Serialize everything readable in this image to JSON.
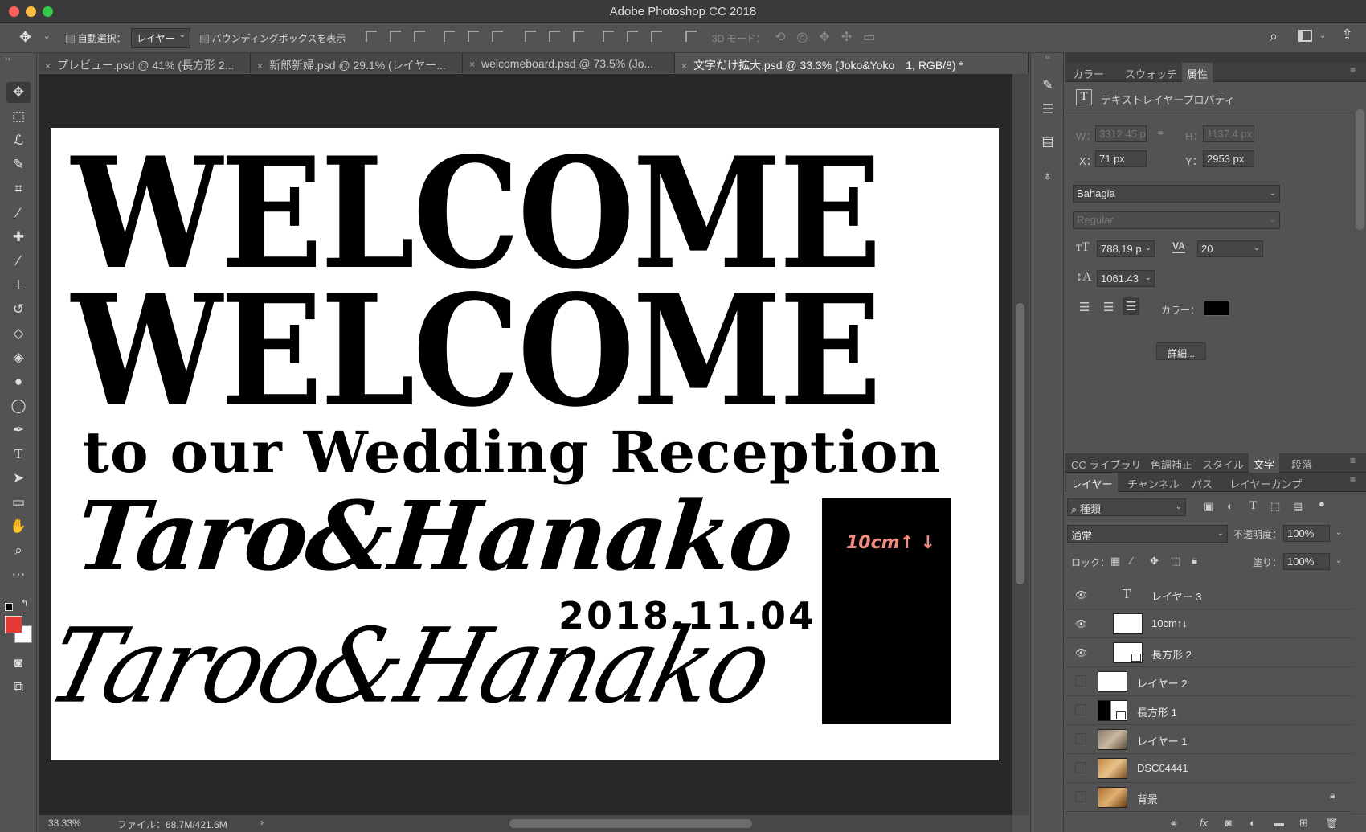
{
  "window": {
    "title": "Adobe Photoshop CC 2018"
  },
  "options_bar": {
    "auto_select_label": "自動選択：",
    "auto_select_target": "レイヤー",
    "bounding_box_label": "バウンディングボックスを表示",
    "mode_3d_label": "3D モード："
  },
  "tabs": [
    {
      "label": "プレビュー.psd @ 41% (長方形 2...",
      "close": "×"
    },
    {
      "label": "新郎新婦.psd @ 29.1% (レイヤー...",
      "close": "×"
    },
    {
      "label": "welcomeboard.psd @ 73.5% (Jo...",
      "close": "×"
    },
    {
      "label": "文字だけ拡大.psd @ 33.3% (Joko&Yoko　1, RGB/8) *",
      "close": "×"
    }
  ],
  "canvas": {
    "line1": "WELCOME",
    "line2": "WELCOME",
    "subtitle": "to our Wedding Reception",
    "names_script1": "Taro&Hanako",
    "date": "2018.11.04",
    "names_script2": "Taroo&Hanako",
    "rect_label": "10cm↑ ↓"
  },
  "status": {
    "zoom": "33.33%",
    "file_info": "ファイル：68.7M/421.6M",
    "arrow": "›"
  },
  "properties_panel": {
    "tabs": [
      "カラー",
      "スウォッチ",
      "属性"
    ],
    "active_tab": "属性",
    "header": "テキストレイヤープロパティ",
    "w_label": "W：",
    "w_value": "3312.45 p",
    "h_label": "H：",
    "h_value": "1137.4 px",
    "x_label": "X：",
    "x_value": "71 px",
    "y_label": "Y：",
    "y_value": "2953 px",
    "font_family": "Bahagia",
    "font_style": "Regular",
    "font_size": "788.19 p",
    "tracking": "20",
    "leading": "1061.43",
    "color_label": "カラー：",
    "color_value": "#000000",
    "details_button": "詳細..."
  },
  "lower_tabs": [
    "CC ライブラリ",
    "色調補正",
    "スタイル",
    "文字",
    "段落"
  ],
  "lower_active_tab": "文字",
  "layers_panel": {
    "tabs": [
      "レイヤー",
      "チャンネル",
      "パス",
      "レイヤーカンプ"
    ],
    "active_tab": "レイヤー",
    "filter_kind": "種類",
    "blend_mode": "通常",
    "opacity_label": "不透明度：",
    "opacity_value": "100%",
    "lock_label": "ロック：",
    "fill_label": "塗り：",
    "fill_value": "100%",
    "layers": [
      {
        "name": "レイヤー 3",
        "visible": true,
        "kind": "text"
      },
      {
        "name": "10cm↑↓",
        "visible": true,
        "kind": "pixel"
      },
      {
        "name": "長方形 2",
        "visible": true,
        "kind": "shape"
      },
      {
        "name": "レイヤー 2",
        "visible": false,
        "kind": "pixel"
      },
      {
        "name": "長方形 1",
        "visible": false,
        "kind": "shape"
      },
      {
        "name": "レイヤー 1",
        "visible": false,
        "kind": "photo"
      },
      {
        "name": "DSC04441",
        "visible": false,
        "kind": "photo"
      },
      {
        "name": "背景",
        "visible": false,
        "kind": "photo"
      }
    ]
  },
  "colors": {
    "foreground": "#e53935",
    "background": "#ffffff",
    "rect_label": "#f08c80"
  }
}
